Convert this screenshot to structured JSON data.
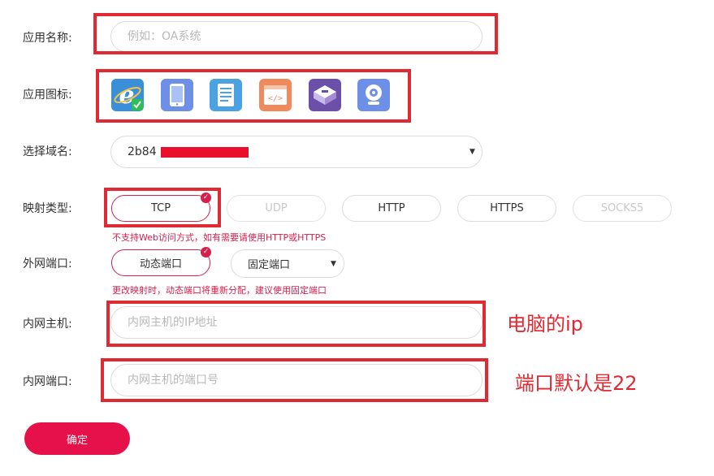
{
  "form": {
    "app_name": {
      "label": "应用名称:",
      "placeholder": "例如：OA系统"
    },
    "app_icon": {
      "label": "应用图标:",
      "icons": [
        "ie-browser-icon",
        "tablet-icon",
        "document-icon",
        "code-window-icon",
        "server-icon",
        "webcam-icon"
      ]
    },
    "domain": {
      "label": "选择域名:",
      "value": "2b84"
    },
    "mapping_type": {
      "label": "映射类型:",
      "options": [
        "TCP",
        "UDP",
        "HTTP",
        "HTTPS",
        "SOCKS5"
      ],
      "selected": "TCP",
      "hint": "不支持Web访问方式，如有需要请使用HTTP或HTTPS"
    },
    "external_port": {
      "label": "外网端口:",
      "options": [
        "动态端口",
        "固定端口"
      ],
      "selected": "动态端口",
      "hint": "更改映射时，动态端口将重新分配，建议使用固定端口"
    },
    "internal_host": {
      "label": "内网主机:",
      "placeholder": "内网主机的IP地址"
    },
    "internal_port": {
      "label": "内网端口:",
      "placeholder": "内网主机的端口号"
    },
    "submit_label": "确定"
  },
  "annotations": {
    "host_note": "电脑的ip",
    "port_note": "端口默认是22"
  },
  "colors": {
    "accent": "#d81e4b",
    "button": "#e6104a",
    "annotation_red": "#e02a33"
  }
}
